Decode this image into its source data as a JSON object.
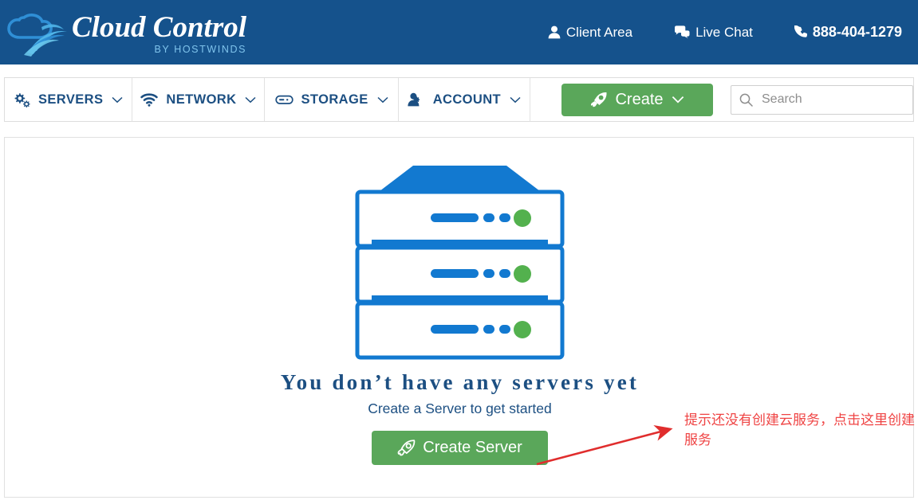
{
  "header": {
    "logo": {
      "title": "Cloud Control",
      "subtitle": "BY HOSTWINDS",
      "icon": "cloud-swoosh-logo"
    },
    "links": [
      {
        "label": "Client Area",
        "icon": "user-icon"
      },
      {
        "label": "Live Chat",
        "icon": "chat-bubbles-icon"
      },
      {
        "label": "888-404-1279",
        "icon": "phone-icon"
      }
    ]
  },
  "nav": {
    "items": [
      {
        "label": "SERVERS",
        "icon": "gears-icon",
        "caret": "chevron-down-icon"
      },
      {
        "label": "NETWORK",
        "icon": "wifi-icon",
        "caret": "chevron-down-icon"
      },
      {
        "label": "STORAGE",
        "icon": "disk-icon",
        "caret": "chevron-down-icon"
      },
      {
        "label": "ACCOUNT",
        "icon": "user-gear-icon",
        "caret": "chevron-down-icon"
      }
    ],
    "create_button": {
      "label": "Create",
      "icon": "rocket-icon",
      "caret": "chevron-down-icon"
    },
    "search": {
      "placeholder": "Search",
      "value": "",
      "icon": "search-icon"
    }
  },
  "main": {
    "illustration": "server-rack-icon",
    "title": "You don’t have any servers yet",
    "subtitle": "Create a Server to get started",
    "create_server_button": {
      "label": "Create Server",
      "icon": "rocket-icon"
    }
  },
  "annotation": {
    "text": "提示还没有创建云服务，点击这里创建服务",
    "arrow": "red-arrow-pointing-upper-right"
  },
  "colors": {
    "header_blue": "#15528c",
    "nav_text_blue": "#1c4f82",
    "accent_green": "#5aa75a",
    "annotation_red": "#ef4444",
    "illustration_blue": "#1279d0",
    "illustration_green": "#53b14e"
  }
}
